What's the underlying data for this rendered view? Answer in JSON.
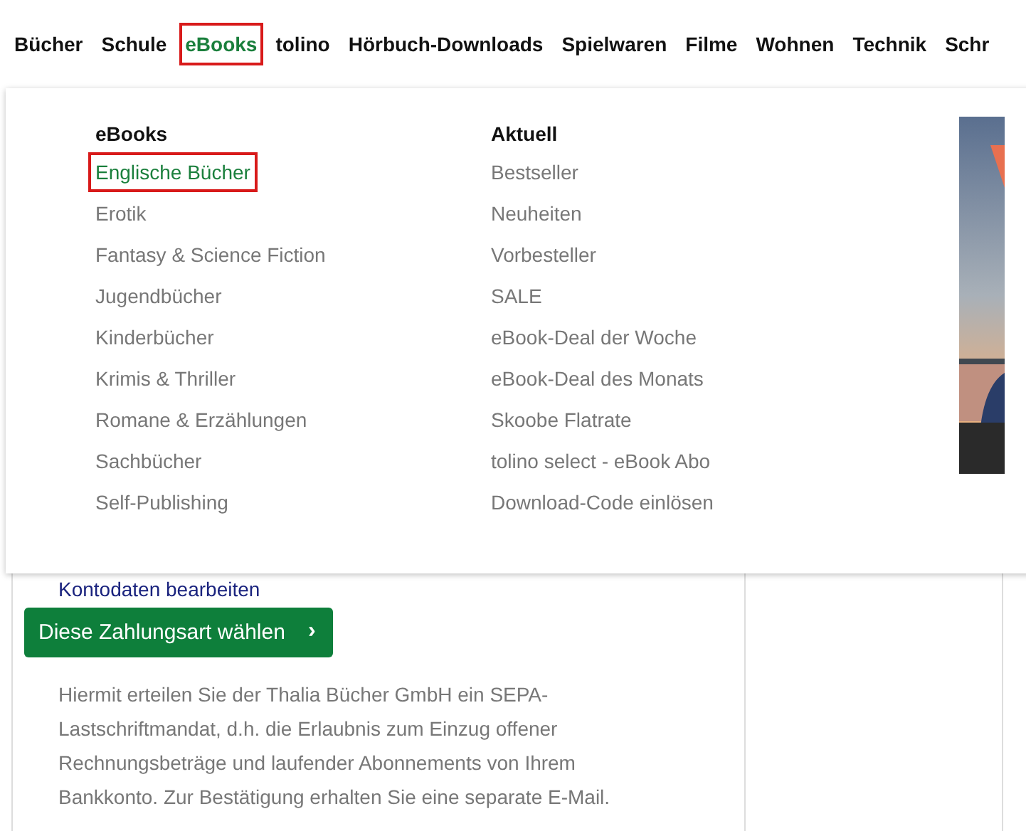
{
  "nav": [
    {
      "label": "Bücher",
      "selected": false,
      "highlighted": false
    },
    {
      "label": "Schule",
      "selected": false,
      "highlighted": false
    },
    {
      "label": "eBooks",
      "selected": true,
      "highlighted": true
    },
    {
      "label": "tolino",
      "selected": false,
      "highlighted": false
    },
    {
      "label": "Hörbuch-Downloads",
      "selected": false,
      "highlighted": false
    },
    {
      "label": "Spielwaren",
      "selected": false,
      "highlighted": false
    },
    {
      "label": "Filme",
      "selected": false,
      "highlighted": false
    },
    {
      "label": "Wohnen",
      "selected": false,
      "highlighted": false
    },
    {
      "label": "Technik",
      "selected": false,
      "highlighted": false
    },
    {
      "label": "Schr",
      "selected": false,
      "highlighted": false
    }
  ],
  "menu": {
    "columns": [
      {
        "heading": "eBooks",
        "items": [
          {
            "label": "Englische Bücher",
            "selected": true,
            "highlighted": true
          },
          {
            "label": "Erotik",
            "selected": false,
            "highlighted": false
          },
          {
            "label": "Fantasy & Science Fiction",
            "selected": false,
            "highlighted": false
          },
          {
            "label": "Jugendbücher",
            "selected": false,
            "highlighted": false
          },
          {
            "label": "Kinderbücher",
            "selected": false,
            "highlighted": false
          },
          {
            "label": "Krimis & Thriller",
            "selected": false,
            "highlighted": false
          },
          {
            "label": "Romane & Erzählungen",
            "selected": false,
            "highlighted": false
          },
          {
            "label": "Sachbücher",
            "selected": false,
            "highlighted": false
          },
          {
            "label": "Self-Publishing",
            "selected": false,
            "highlighted": false
          }
        ]
      },
      {
        "heading": "Aktuell",
        "items": [
          {
            "label": "Bestseller",
            "selected": false,
            "highlighted": false
          },
          {
            "label": "Neuheiten",
            "selected": false,
            "highlighted": false
          },
          {
            "label": "Vorbesteller",
            "selected": false,
            "highlighted": false
          },
          {
            "label": "SALE",
            "selected": false,
            "highlighted": false
          },
          {
            "label": "eBook-Deal der Woche",
            "selected": false,
            "highlighted": false
          },
          {
            "label": "eBook-Deal des Monats",
            "selected": false,
            "highlighted": false
          },
          {
            "label": "Skoobe Flatrate",
            "selected": false,
            "highlighted": false
          },
          {
            "label": "tolino select - eBook Abo",
            "selected": false,
            "highlighted": false
          },
          {
            "label": "Download-Code einlösen",
            "selected": false,
            "highlighted": false
          }
        ]
      }
    ]
  },
  "payment": {
    "edit_link": "Kontodaten bearbeiten",
    "button": "Diese Zahlungsart wählen",
    "button_icon": "›",
    "notice": "Hiermit erteilen Sie der Thalia Bücher GmbH ein SEPA-Lastschriftmandat, d.h. die Erlaubnis zum Einzug offener Rechnungsbeträge und laufender Abonnements von Ihrem Bankkonto. Zur Bestätigung erhalten Sie eine separate E-Mail."
  }
}
